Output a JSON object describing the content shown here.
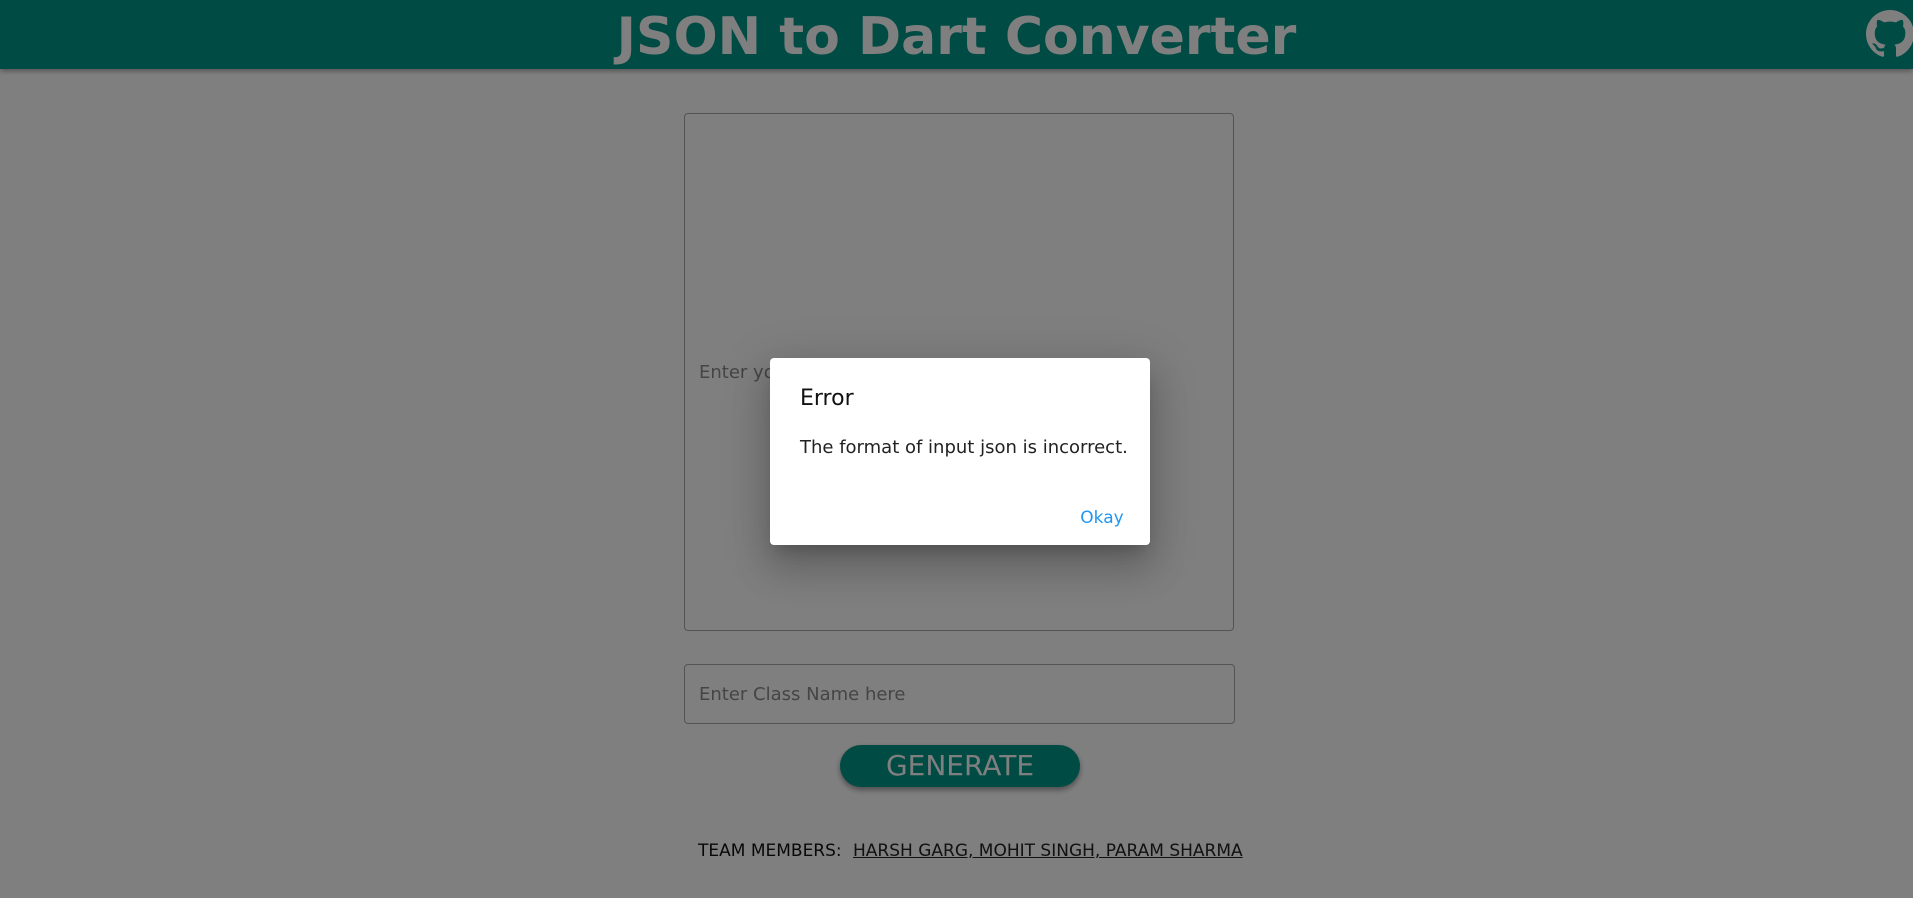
{
  "header": {
    "title": "JSON to Dart Converter",
    "github_icon": "github-icon",
    "background_color": "#009688",
    "title_color": "#ffffff"
  },
  "form": {
    "json_input_placeholder": "Enter your JSON here",
    "class_name_placeholder": "Enter Class Name here",
    "generate_label": "GENERATE",
    "accent_color": "#009688"
  },
  "footer": {
    "label": "TEAM MEMBERS:",
    "names": "HARSH GARG, MOHIT SINGH, PARAM SHARMA"
  },
  "dialog": {
    "title": "Error",
    "message": "The format of input json is incorrect.",
    "ok_label": "Okay",
    "ok_color": "#2196f3"
  }
}
